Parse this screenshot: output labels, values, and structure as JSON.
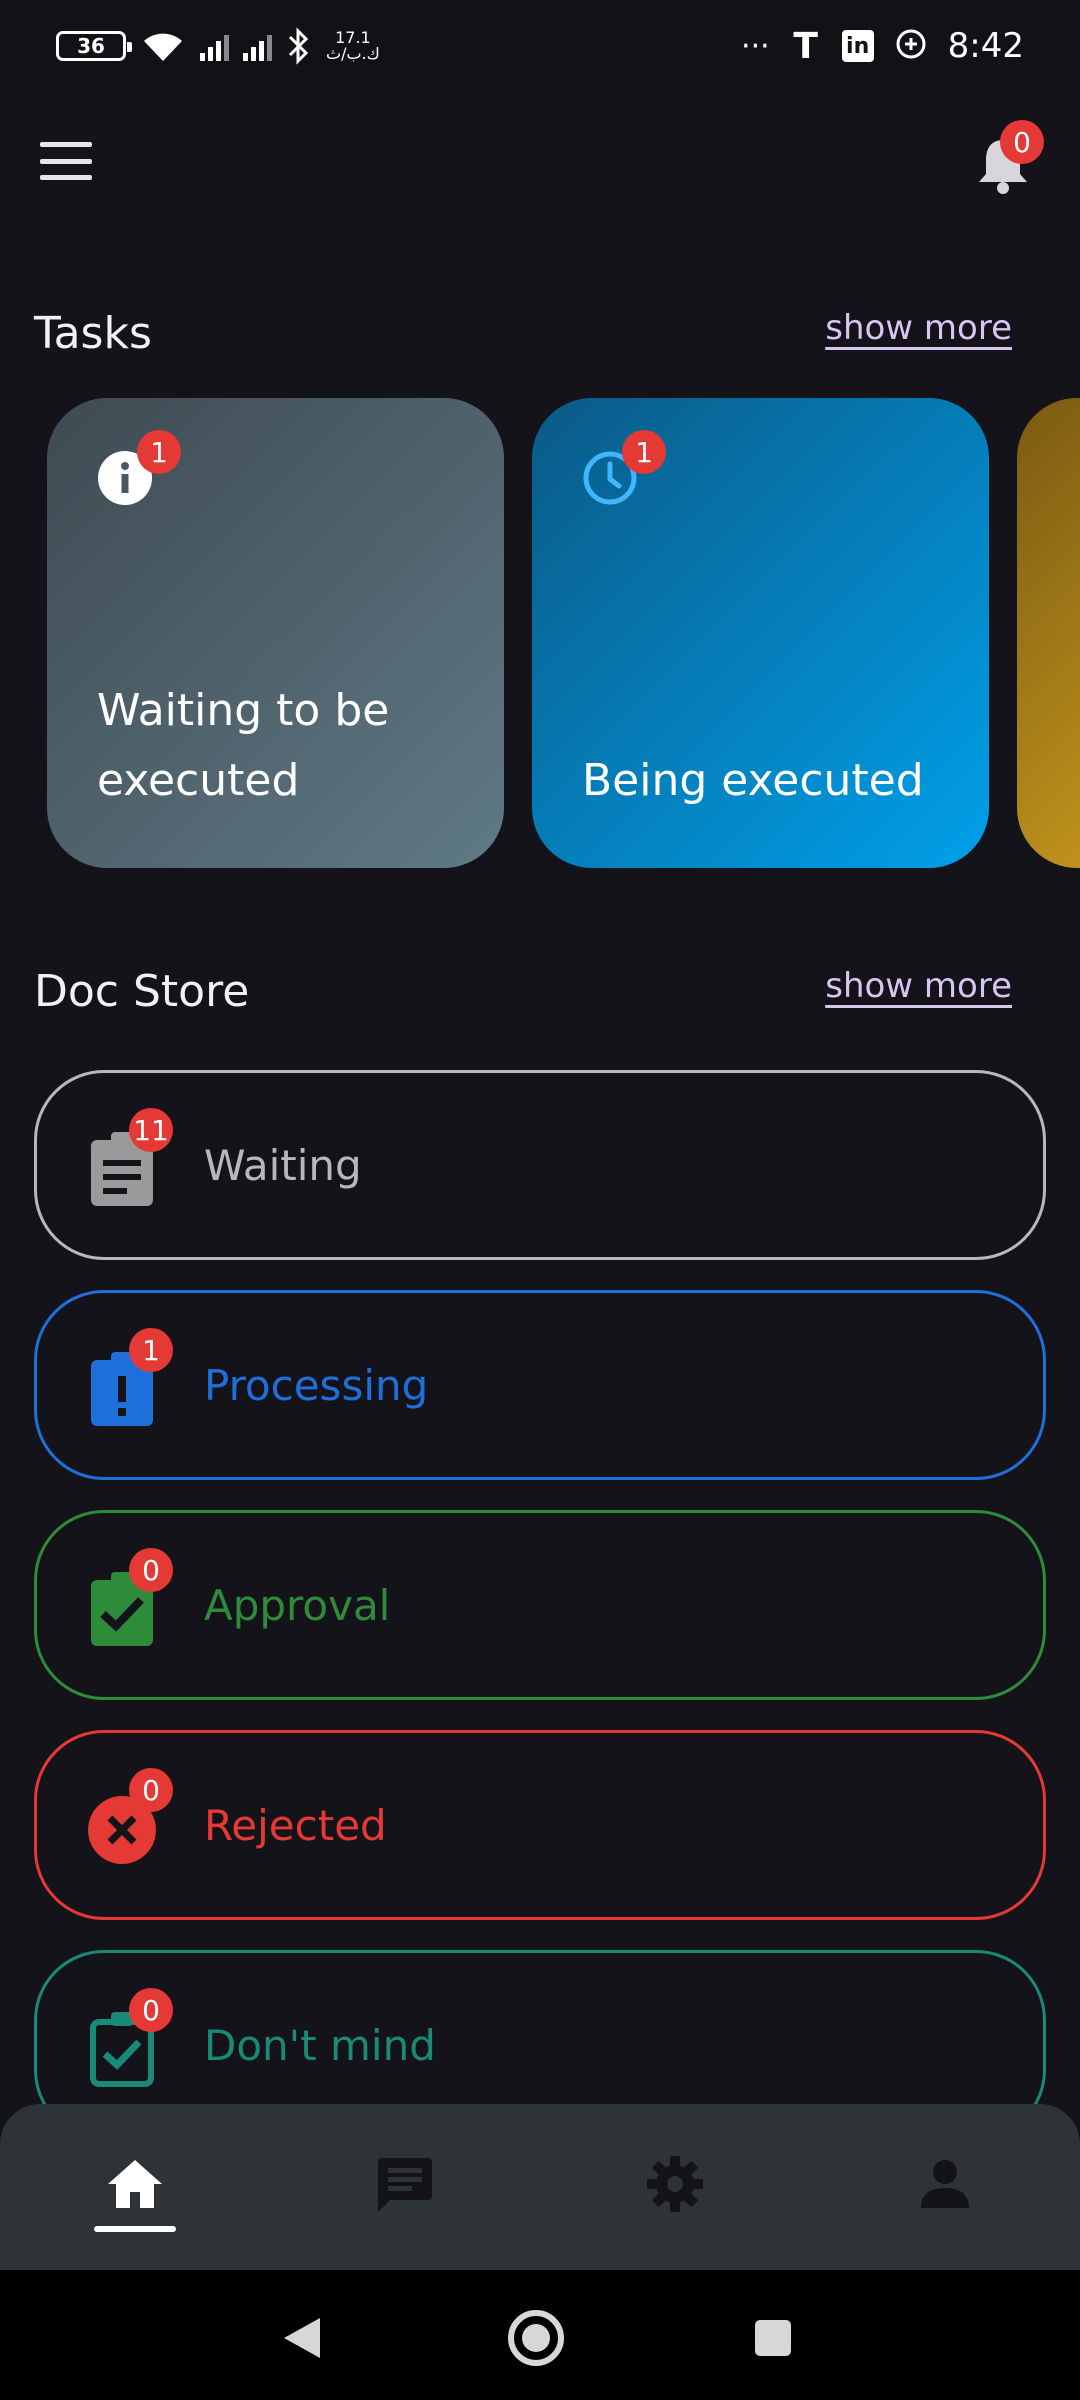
{
  "status_bar": {
    "battery": "36",
    "speed_value": "17.1",
    "speed_unit": "ك.ب/ث",
    "more": "···",
    "app_t": "T",
    "app_in": "in",
    "time": "8:42"
  },
  "header": {
    "menu_icon": "hamburger-icon",
    "notifications_count": "0"
  },
  "tasks": {
    "title": "Tasks",
    "show_more": "show more",
    "cards": [
      {
        "label": "Waiting to be executed",
        "badge": "1",
        "icon": "info-icon"
      },
      {
        "label": "Being executed",
        "badge": "1",
        "icon": "clock-icon"
      }
    ]
  },
  "doc_store": {
    "title": "Doc Store",
    "show_more": "show more",
    "items": [
      {
        "label": "Waiting",
        "badge": "11",
        "color": "#b8b8b8",
        "icon": "clipboard-text-icon"
      },
      {
        "label": "Processing",
        "badge": "1",
        "color": "#1e6fd9",
        "icon": "clipboard-alert-icon"
      },
      {
        "label": "Approval",
        "badge": "0",
        "color": "#2e8b3a",
        "icon": "clipboard-check-icon"
      },
      {
        "label": "Rejected",
        "badge": "0",
        "color": "#e53935",
        "icon": "close-circle-icon"
      },
      {
        "label": "Don't mind",
        "badge": "0",
        "color": "#1a8a78",
        "icon": "clipboard-check-outline-icon"
      }
    ]
  },
  "bottom_nav": [
    "home-icon",
    "chat-icon",
    "gear-icon",
    "person-icon"
  ],
  "colors": {
    "background": "#15131a",
    "badge": "#e53935",
    "link": "#d5c6f2"
  }
}
